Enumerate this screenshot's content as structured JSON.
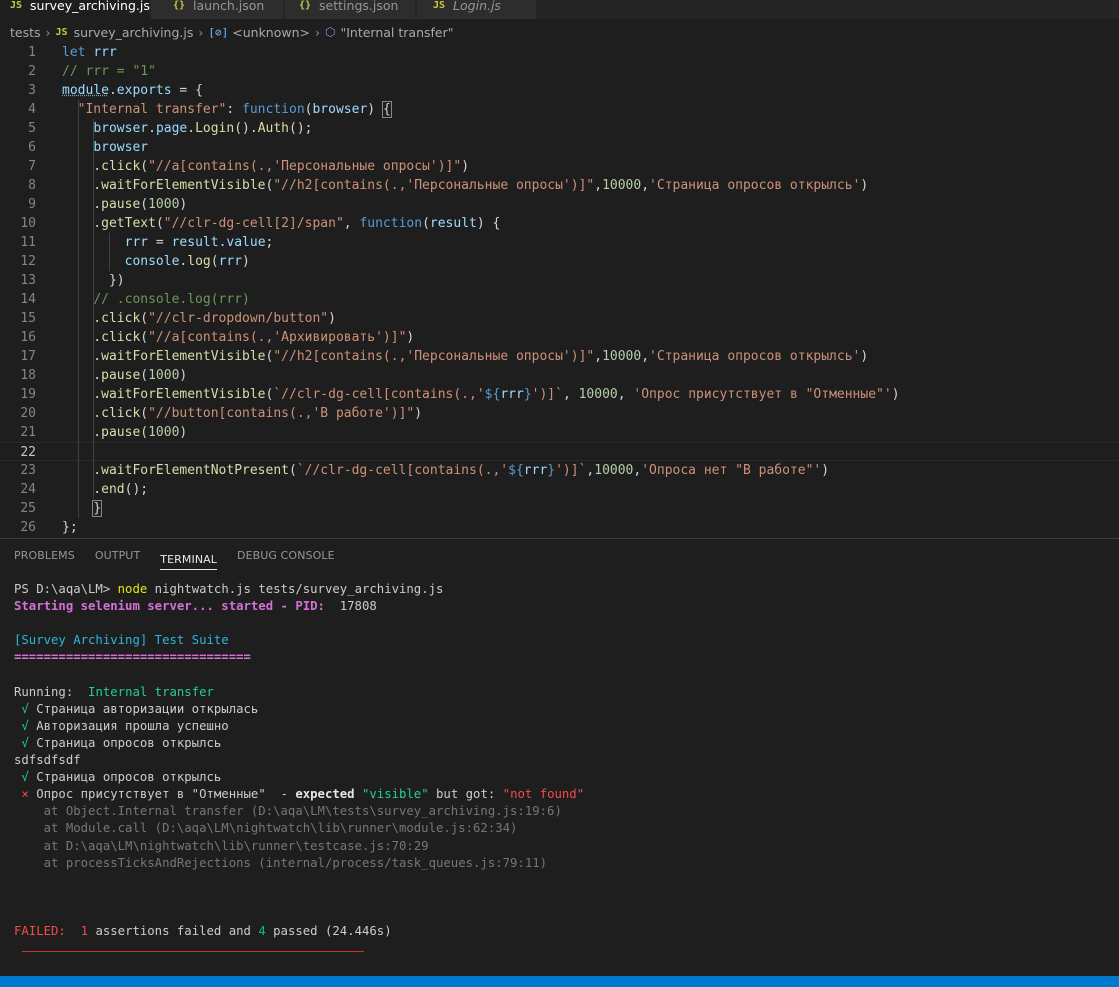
{
  "tabs": [
    {
      "icon": "JS",
      "label": "survey_archiving.js",
      "active": true,
      "close": "×"
    },
    {
      "icon": "{}",
      "label": "launch.json",
      "active": false
    },
    {
      "icon": "{}",
      "label": "settings.json",
      "active": false
    },
    {
      "icon": "JS",
      "label": "Login.js",
      "active": false
    }
  ],
  "breadcrumb": {
    "folder": "tests",
    "file_icon": "JS",
    "file": "survey_archiving.js",
    "symbol_icon": "[⊘]",
    "symbol": "<unknown>",
    "member": "\"Internal transfer\""
  },
  "editor": {
    "line_numbers": [
      "1",
      "2",
      "3",
      "4",
      "5",
      "6",
      "7",
      "8",
      "9",
      "10",
      "11",
      "12",
      "13",
      "14",
      "15",
      "16",
      "17",
      "18",
      "19",
      "20",
      "21",
      "22",
      "23",
      "24",
      "25",
      "26"
    ],
    "current_line": 22,
    "lines": [
      [
        [
          "k",
          "let"
        ],
        [
          "p",
          " "
        ],
        [
          "v",
          "rrr"
        ]
      ],
      [
        [
          "c",
          "// rrr = \"1\""
        ]
      ],
      [
        [
          "v",
          "module"
        ],
        [
          "p",
          "."
        ],
        [
          "v",
          "exports"
        ],
        [
          "p",
          " = {"
        ]
      ],
      [
        [
          "p",
          "  "
        ],
        [
          "s",
          "\"Internal transfer\""
        ],
        [
          "p",
          ": "
        ],
        [
          "k",
          "function"
        ],
        [
          "p",
          "("
        ],
        [
          "v",
          "browser"
        ],
        [
          "p",
          ") "
        ],
        [
          "p",
          "{"
        ]
      ],
      [
        [
          "p",
          "    "
        ],
        [
          "v",
          "browser"
        ],
        [
          "p",
          "."
        ],
        [
          "v",
          "page"
        ],
        [
          "p",
          "."
        ],
        [
          "f",
          "Login"
        ],
        [
          "p",
          "()."
        ],
        [
          "f",
          "Auth"
        ],
        [
          "p",
          "();"
        ]
      ],
      [
        [
          "p",
          "    "
        ],
        [
          "v",
          "browser"
        ]
      ],
      [
        [
          "p",
          "    ."
        ],
        [
          "f",
          "click"
        ],
        [
          "p",
          "("
        ],
        [
          "s",
          "\"//a[contains(.,'Персональные опросы')]\""
        ],
        [
          "p",
          ")"
        ]
      ],
      [
        [
          "p",
          "    ."
        ],
        [
          "f",
          "waitForElementVisible"
        ],
        [
          "p",
          "("
        ],
        [
          "s",
          "\"//h2[contains(.,'Персональные опросы')]\""
        ],
        [
          "p",
          ","
        ],
        [
          "n",
          "10000"
        ],
        [
          "p",
          ","
        ],
        [
          "s",
          "'Страница опросов открылсь'"
        ],
        [
          "p",
          ")"
        ]
      ],
      [
        [
          "p",
          "    ."
        ],
        [
          "f",
          "pause"
        ],
        [
          "p",
          "("
        ],
        [
          "n",
          "1000"
        ],
        [
          "p",
          ")"
        ]
      ],
      [
        [
          "p",
          "    ."
        ],
        [
          "f",
          "getText"
        ],
        [
          "p",
          "("
        ],
        [
          "s",
          "\"//clr-dg-cell[2]/span\""
        ],
        [
          "p",
          ", "
        ],
        [
          "k",
          "function"
        ],
        [
          "p",
          "("
        ],
        [
          "v",
          "result"
        ],
        [
          "p",
          ") {"
        ]
      ],
      [
        [
          "p",
          "        "
        ],
        [
          "v",
          "rrr"
        ],
        [
          "p",
          " = "
        ],
        [
          "v",
          "result"
        ],
        [
          "p",
          "."
        ],
        [
          "v",
          "value"
        ],
        [
          "p",
          ";"
        ]
      ],
      [
        [
          "p",
          "        "
        ],
        [
          "v",
          "console"
        ],
        [
          "p",
          "."
        ],
        [
          "f",
          "log"
        ],
        [
          "p",
          "("
        ],
        [
          "v",
          "rrr"
        ],
        [
          "p",
          ")"
        ]
      ],
      [
        [
          "p",
          "      })"
        ]
      ],
      [
        [
          "p",
          "    "
        ],
        [
          "c",
          "// .console.log(rrr)"
        ]
      ],
      [
        [
          "p",
          "    ."
        ],
        [
          "f",
          "click"
        ],
        [
          "p",
          "("
        ],
        [
          "s",
          "\"//clr-dropdown/button\""
        ],
        [
          "p",
          ")"
        ]
      ],
      [
        [
          "p",
          "    ."
        ],
        [
          "f",
          "click"
        ],
        [
          "p",
          "("
        ],
        [
          "s",
          "\"//a[contains(.,'Архивировать')]\""
        ],
        [
          "p",
          ")"
        ]
      ],
      [
        [
          "p",
          "    ."
        ],
        [
          "f",
          "waitForElementVisible"
        ],
        [
          "p",
          "("
        ],
        [
          "s",
          "\"//h2[contains(.,'Персональные опросы')]\""
        ],
        [
          "p",
          ","
        ],
        [
          "n",
          "10000"
        ],
        [
          "p",
          ","
        ],
        [
          "s",
          "'Страница опросов открылсь'"
        ],
        [
          "p",
          ")"
        ]
      ],
      [
        [
          "p",
          "    ."
        ],
        [
          "f",
          "pause"
        ],
        [
          "p",
          "("
        ],
        [
          "n",
          "1000"
        ],
        [
          "p",
          ")"
        ]
      ],
      [
        [
          "p",
          "    ."
        ],
        [
          "f",
          "waitForElementVisible"
        ],
        [
          "p",
          "("
        ],
        [
          "s",
          "`//clr-dg-cell[contains(.,'"
        ],
        [
          "tv",
          "${"
        ],
        [
          "v",
          "rrr"
        ],
        [
          "tv",
          "}"
        ],
        [
          "s",
          "')]`"
        ],
        [
          "p",
          ", "
        ],
        [
          "n",
          "10000"
        ],
        [
          "p",
          ", "
        ],
        [
          "s",
          "'Опрос присутствует в \"Отменные\"'"
        ],
        [
          "p",
          ")"
        ]
      ],
      [
        [
          "p",
          "    ."
        ],
        [
          "f",
          "click"
        ],
        [
          "p",
          "("
        ],
        [
          "s",
          "\"//button[contains(.,'В работе')]\""
        ],
        [
          "p",
          ")"
        ]
      ],
      [
        [
          "p",
          "    ."
        ],
        [
          "f",
          "pause"
        ],
        [
          "p",
          "("
        ],
        [
          "n",
          "1000"
        ],
        [
          "p",
          ")"
        ]
      ],
      [],
      [
        [
          "p",
          "    ."
        ],
        [
          "f",
          "waitForElementNotPresent"
        ],
        [
          "p",
          "("
        ],
        [
          "s",
          "`//clr-dg-cell[contains(.,'"
        ],
        [
          "tv",
          "${"
        ],
        [
          "v",
          "rrr"
        ],
        [
          "tv",
          "}"
        ],
        [
          "s",
          "')]`"
        ],
        [
          "p",
          ","
        ],
        [
          "n",
          "10000"
        ],
        [
          "p",
          ","
        ],
        [
          "s",
          "'Опроса нет \"В работе\"'"
        ],
        [
          "p",
          ")"
        ]
      ],
      [
        [
          "p",
          "    ."
        ],
        [
          "f",
          "end"
        ],
        [
          "p",
          "();"
        ]
      ],
      [
        [
          "p",
          "    "
        ],
        [
          "p",
          "}"
        ]
      ],
      [
        [
          "p",
          "};"
        ]
      ]
    ]
  },
  "panel": {
    "tabs": [
      "PROBLEMS",
      "OUTPUT",
      "TERMINAL",
      "DEBUG CONSOLE"
    ],
    "active_tab": "TERMINAL"
  },
  "terminal": {
    "lines": [
      [
        [
          "t-white",
          "PS D:\\aqa\\LM> "
        ],
        [
          "t-yellow",
          "node"
        ],
        [
          "t-white",
          " nightwatch.js tests/survey_archiving.js"
        ]
      ],
      [
        [
          "t-magenta",
          "Starting selenium server... started - PID:  "
        ],
        [
          "t-white",
          "17808"
        ]
      ],
      [],
      [
        [
          "t-cyan",
          "[Survey Archiving] Test Suite"
        ]
      ],
      [
        [
          "t-magenta",
          "================================"
        ]
      ],
      [],
      [
        [
          "t-white",
          "Running:  "
        ],
        [
          "t-green",
          "Internal transfer"
        ]
      ],
      [
        [
          "t-green",
          " √"
        ],
        [
          "t-white",
          " Страница авторизации открылась"
        ]
      ],
      [
        [
          "t-green",
          " √"
        ],
        [
          "t-white",
          " Авторизация прошла успешно"
        ]
      ],
      [
        [
          "t-green",
          " √"
        ],
        [
          "t-white",
          " Страница опросов открылсь"
        ]
      ],
      [
        [
          "t-white",
          "sdfsdfsdf"
        ]
      ],
      [
        [
          "t-green",
          " √"
        ],
        [
          "t-white",
          " Страница опросов открылсь"
        ]
      ],
      [
        [
          "t-red",
          " ×"
        ],
        [
          "t-white",
          " Опрос присутствует в \"Отменные\"  - "
        ],
        [
          "t-bold",
          "expected "
        ],
        [
          "t-green",
          "\"visible\""
        ],
        [
          "t-white",
          " but got: "
        ],
        [
          "t-red",
          "\"not found\""
        ]
      ],
      [
        [
          "t-gray",
          "    at Object.Internal transfer (D:\\aqa\\LM\\tests\\survey_archiving.js:19:6)"
        ]
      ],
      [
        [
          "t-gray",
          "    at Module.call (D:\\aqa\\LM\\nightwatch\\lib\\runner\\module.js:62:34)"
        ]
      ],
      [
        [
          "t-gray",
          "    at D:\\aqa\\LM\\nightwatch\\lib\\runner\\testcase.js:70:29"
        ]
      ],
      [
        [
          "t-gray",
          "    at processTicksAndRejections (internal/process/task_queues.js:79:11)"
        ]
      ],
      [],
      [],
      [],
      [
        [
          "t-red",
          "FAILED:  "
        ],
        [
          "t-red",
          "1"
        ],
        [
          "t-white",
          " assertions failed and "
        ],
        [
          "t-green2",
          "4"
        ],
        [
          "t-white",
          " passed (24.446s)"
        ]
      ]
    ]
  },
  "colors": {
    "editor_bg": "#1e1e1e",
    "status_bar": "#007acc",
    "fail_red": "#cd3131"
  }
}
